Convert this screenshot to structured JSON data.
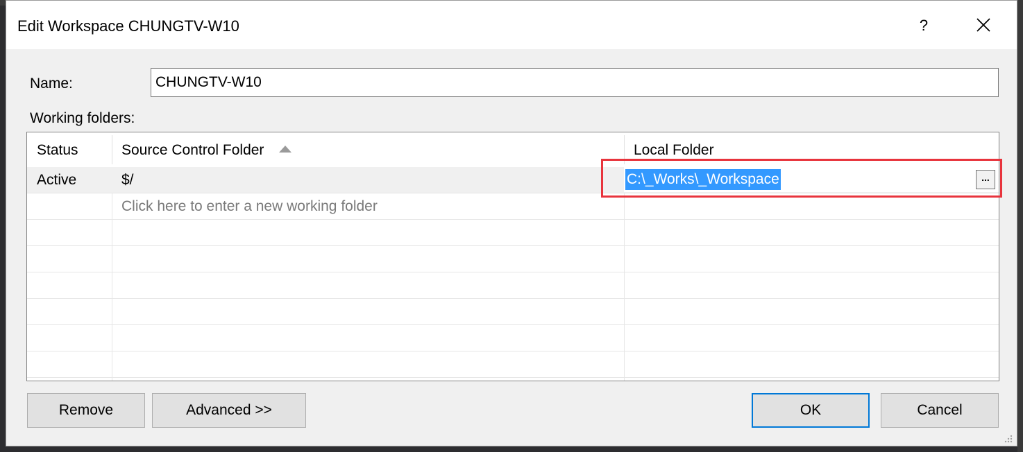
{
  "dialog": {
    "title": "Edit Workspace CHUNGTV-W10",
    "help_label": "?",
    "close_icon": "close-icon"
  },
  "form": {
    "name_label": "Name:",
    "name_value": "CHUNGTV-W10",
    "working_folders_label": "Working folders:"
  },
  "grid": {
    "columns": [
      "Status",
      "Source Control Folder",
      "Local Folder"
    ],
    "sorted_column": "Source Control Folder",
    "sort_icon": "sort-ascending-icon",
    "rows": [
      {
        "status": "Active",
        "source": "$/",
        "local": "C:\\_Works\\_Workspace"
      }
    ],
    "new_row_placeholder": "Click here to enter a new working folder",
    "browse_label": "..."
  },
  "buttons": {
    "remove": "Remove",
    "advanced": "Advanced >>",
    "ok": "OK",
    "cancel": "Cancel"
  },
  "colors": {
    "selection": "#3399ff",
    "highlight_box": "#e8343d",
    "default_button_border": "#0078d7"
  }
}
